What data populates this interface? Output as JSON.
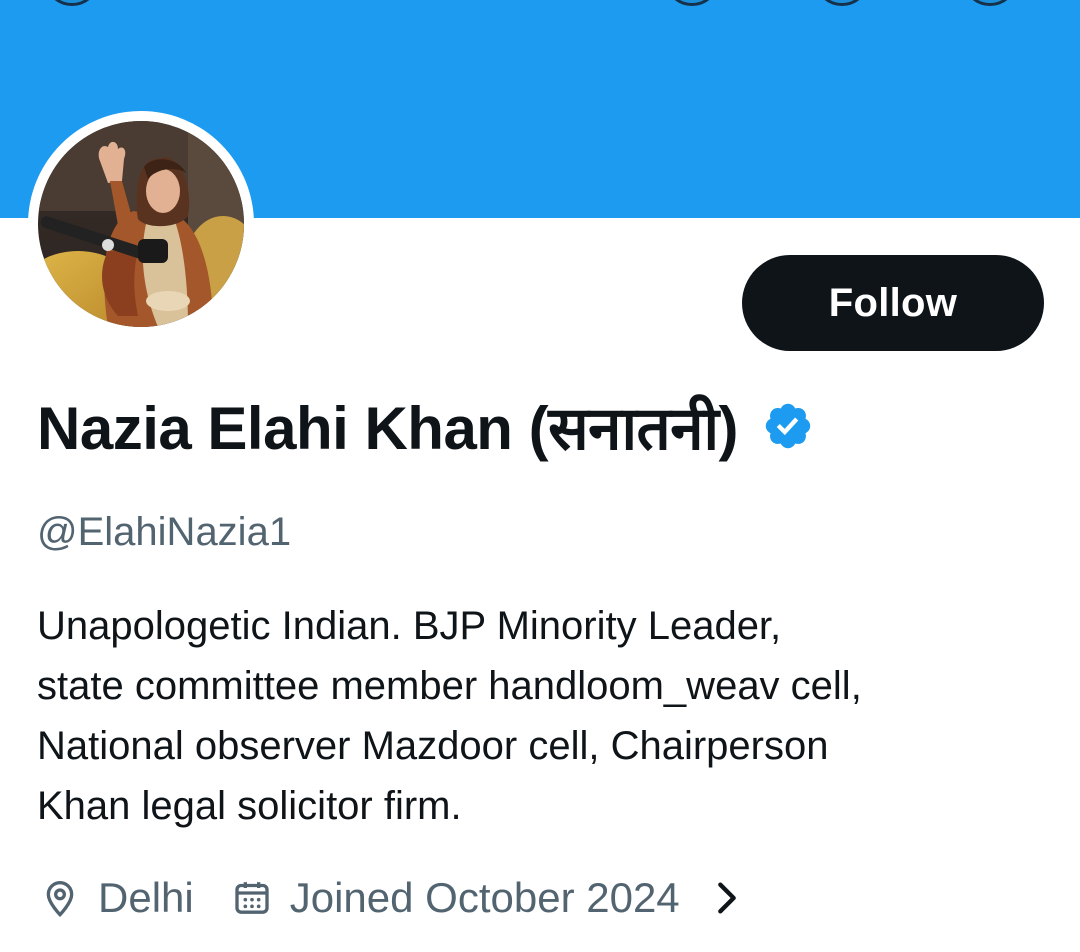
{
  "profile": {
    "display_name": "Nazia Elahi Khan (सनातनी)",
    "handle": "@ElahiNazia1",
    "verified": true,
    "bio_lines": [
      "Unapologetic Indian. BJP Minority Leader,",
      "state committee member handloom_weav cell,",
      "National observer Mazdoor cell, Chairperson",
      "Khan legal solicitor firm."
    ],
    "location": "Delhi",
    "joined": "Joined October 2024"
  },
  "actions": {
    "follow_label": "Follow"
  },
  "icons": {
    "location": "location-pin-icon",
    "joined": "calendar-icon",
    "verified": "verified-badge-icon",
    "more": "chevron-right-icon"
  },
  "colors": {
    "banner": "#1d9bf0",
    "follow_bg": "#0f1419",
    "verified": "#1d9bf0",
    "secondary_text": "#536471"
  }
}
